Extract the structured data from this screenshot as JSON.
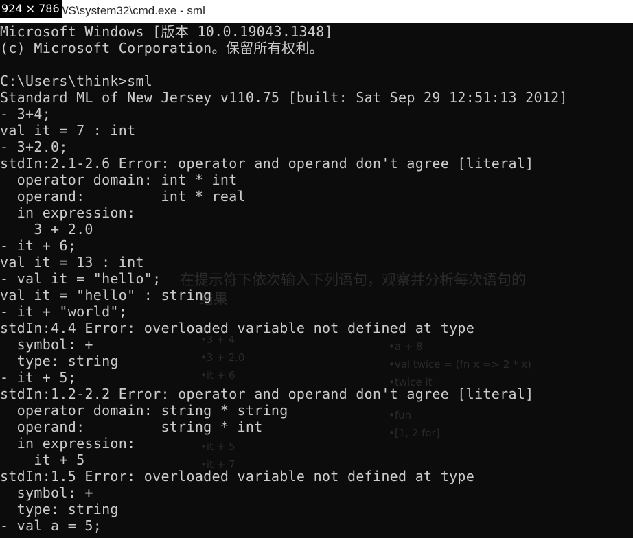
{
  "window": {
    "size_badge": "924 × 786",
    "title": "DOWS\\system32\\cmd.exe - sml",
    "background_color": "#0c0c0c",
    "text_color": "#cccccc"
  },
  "console": {
    "lines": [
      "Microsoft Windows [版本 10.0.19043.1348]",
      "(c) Microsoft Corporation。保留所有权利。",
      "",
      "C:\\Users\\think>sml",
      "Standard ML of New Jersey v110.75 [built: Sat Sep 29 12:51:13 2012]",
      "- 3+4;",
      "val it = 7 : int",
      "- 3+2.0;",
      "stdIn:2.1-2.6 Error: operator and operand don't agree [literal]",
      "  operator domain: int * int",
      "  operand:         int * real",
      "  in expression:",
      "    3 + 2.0",
      "- it + 6;",
      "val it = 13 : int",
      "- val it = \"hello\";",
      "val it = \"hello\" : string",
      "- it + \"world\";",
      "stdIn:4.4 Error: overloaded variable not defined at type",
      "  symbol: +",
      "  type: string",
      "- it + 5;",
      "stdIn:1.2-2.2 Error: operator and operand don't agree [literal]",
      "  operator domain: string * string",
      "  operand:         string * int",
      "  in expression:",
      "    it + 5",
      "stdIn:1.5 Error: overloaded variable not defined at type",
      "  symbol: +",
      "  type: string",
      "- val a = 5;"
    ]
  },
  "background_ghost": {
    "heading_line1": "在提示符下依次输入下列语句，观察并分析每次语句的",
    "heading_line2": "结果",
    "bullets_left": [
      "3 + 4",
      "3 + 2.0",
      "it + 6",
      "it + 5",
      "it + 7"
    ],
    "bullets_right": [
      "a + 8",
      "val twice = (fn x => 2 * x)",
      "twice it",
      "fun",
      "[1, 2 for]"
    ]
  }
}
